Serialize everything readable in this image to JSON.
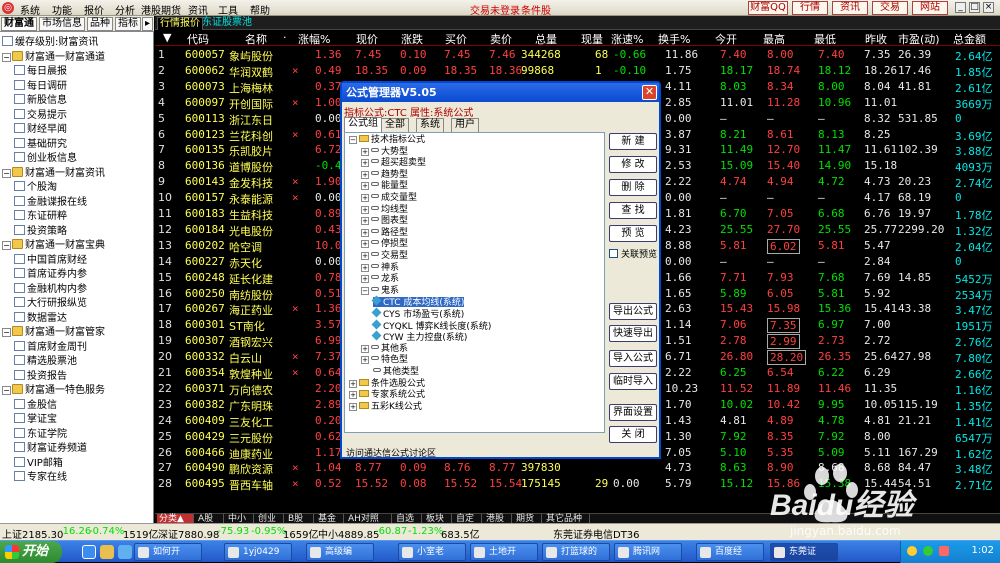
{
  "menubar": {
    "items": [
      "系统",
      "功能",
      "报价",
      "分析",
      "港股期货",
      "资讯",
      "工具",
      "帮助"
    ],
    "login_status": "交易未登录",
    "alert": "条件股",
    "right_buttons": [
      "财富QQ",
      "行情",
      "资讯",
      "交易",
      "网站"
    ]
  },
  "sidebar": {
    "tabs": [
      "财富通",
      "市场信息",
      "品种",
      "指标"
    ],
    "items": [
      {
        "type": "doc",
        "label": "缓存级别:财富资讯",
        "indent": 0
      },
      {
        "type": "folder",
        "label": "财富通一财富通道",
        "indent": 0
      },
      {
        "type": "doc",
        "label": "每日晨报",
        "indent": 1
      },
      {
        "type": "doc",
        "label": "每日调研",
        "indent": 1
      },
      {
        "type": "doc",
        "label": "新股信息",
        "indent": 1
      },
      {
        "type": "doc",
        "label": "交易提示",
        "indent": 1
      },
      {
        "type": "doc",
        "label": "财经早闻",
        "indent": 1
      },
      {
        "type": "doc",
        "label": "基础研究",
        "indent": 1
      },
      {
        "type": "doc",
        "label": "创业板信息",
        "indent": 1
      },
      {
        "type": "folder",
        "label": "财富通一财富资讯",
        "indent": 0
      },
      {
        "type": "doc",
        "label": "个股淘",
        "indent": 1
      },
      {
        "type": "doc",
        "label": "金融谍报在线",
        "indent": 1
      },
      {
        "type": "doc",
        "label": "东证研粹",
        "indent": 1
      },
      {
        "type": "doc",
        "label": "投资策略",
        "indent": 1
      },
      {
        "type": "folder",
        "label": "财富通一财富宝典",
        "indent": 0
      },
      {
        "type": "doc",
        "label": "中国首席财经",
        "indent": 1
      },
      {
        "type": "doc",
        "label": "首席证券内参",
        "indent": 1
      },
      {
        "type": "doc",
        "label": "金融机构内参",
        "indent": 1
      },
      {
        "type": "doc",
        "label": "大行研报纵览",
        "indent": 1
      },
      {
        "type": "doc",
        "label": "数据雷达",
        "indent": 1
      },
      {
        "type": "folder",
        "label": "财富通一财富管家",
        "indent": 0
      },
      {
        "type": "doc",
        "label": "首席财金周刊",
        "indent": 1
      },
      {
        "type": "doc",
        "label": "精选股票池",
        "indent": 1
      },
      {
        "type": "doc",
        "label": "投资报告",
        "indent": 1
      },
      {
        "type": "folder",
        "label": "财富通一特色服务",
        "indent": 0
      },
      {
        "type": "doc",
        "label": "金股信",
        "indent": 1
      },
      {
        "type": "doc",
        "label": "掌证宝",
        "indent": 1
      },
      {
        "type": "doc",
        "label": "东证学院",
        "indent": 1
      },
      {
        "type": "doc",
        "label": "财富证券频道",
        "indent": 1
      },
      {
        "type": "doc",
        "label": "VIP邮箱",
        "indent": 1
      },
      {
        "type": "doc",
        "label": "专家在线",
        "indent": 1
      }
    ]
  },
  "main": {
    "tabs": [
      "行情报价",
      "东证股票池"
    ],
    "columns": [
      "代码",
      "名称",
      "·",
      "涨幅%",
      "现价",
      "涨跌",
      "买价",
      "卖价",
      "总量",
      "现量",
      "涨速%",
      "换手%",
      "今开",
      "最高",
      "最低",
      "昨收",
      "市盈(动)",
      "总金额"
    ],
    "rows": [
      {
        "n": "1",
        "code": "600057",
        "name": "象屿股份",
        "flag": "",
        "chg": "1.36",
        "price": "7.45",
        "diff": "0.10",
        "bid": "7.45",
        "ask": "7.46",
        "vol": "344268",
        "cur": "68",
        "speed": "-0.66",
        "turn": "11.86",
        "open": "7.40",
        "high": "8.00",
        "low": "7.40",
        "prev": "7.35",
        "pe": "26.39",
        "amt": "2.64亿"
      },
      {
        "n": "2",
        "code": "600062",
        "name": "华润双鹤",
        "flag": "×",
        "chg": "0.49",
        "price": "18.35",
        "diff": "0.09",
        "bid": "18.35",
        "ask": "18.36",
        "vol": "99868",
        "cur": "1",
        "speed": "-0.10",
        "turn": "1.75",
        "open": "18.17",
        "high": "18.74",
        "low": "18.12",
        "prev": "18.26",
        "pe": "17.46",
        "amt": "1.85亿"
      },
      {
        "n": "3",
        "code": "600073",
        "name": "上海梅林",
        "flag": "",
        "chg": "0.37",
        "price": "",
        "diff": "",
        "bid": "",
        "ask": "",
        "vol": "",
        "cur": "",
        "speed": "",
        "turn": "4.11",
        "open": "8.03",
        "high": "8.34",
        "low": "8.00",
        "prev": "8.04",
        "pe": "41.81",
        "amt": "2.61亿"
      },
      {
        "n": "4",
        "code": "600097",
        "name": "开创国际",
        "flag": "×",
        "chg": "1.00",
        "price": "",
        "diff": "",
        "bid": "",
        "ask": "",
        "vol": "",
        "cur": "",
        "speed": "",
        "turn": "2.85",
        "open": "11.01",
        "high": "11.28",
        "low": "10.96",
        "prev": "11.01",
        "pe": "",
        "amt": "3669万"
      },
      {
        "n": "5",
        "code": "600113",
        "name": "浙江东日",
        "flag": "",
        "chg": "0.00",
        "price": "",
        "diff": "",
        "bid": "",
        "ask": "",
        "vol": "",
        "cur": "",
        "speed": "",
        "turn": "0.00",
        "open": "—",
        "high": "—",
        "low": "—",
        "prev": "8.32",
        "pe": "531.85",
        "amt": "0"
      },
      {
        "n": "6",
        "code": "600123",
        "name": "兰花科创",
        "flag": "×",
        "chg": "0.61",
        "price": "",
        "diff": "",
        "bid": "",
        "ask": "",
        "vol": "",
        "cur": "",
        "speed": "",
        "turn": "3.87",
        "open": "8.21",
        "high": "8.61",
        "low": "8.13",
        "prev": "8.25",
        "pe": "",
        "amt": "3.69亿"
      },
      {
        "n": "7",
        "code": "600135",
        "name": "乐凯胶片",
        "flag": "",
        "chg": "6.72",
        "price": "",
        "diff": "",
        "bid": "",
        "ask": "",
        "vol": "",
        "cur": "",
        "speed": "",
        "turn": "9.31",
        "open": "11.49",
        "high": "12.70",
        "low": "11.47",
        "prev": "11.61",
        "pe": "102.39",
        "amt": "3.88亿"
      },
      {
        "n": "8",
        "code": "600136",
        "name": "道博股份",
        "flag": "",
        "chg": "-0.40",
        "price": "",
        "diff": "",
        "bid": "",
        "ask": "",
        "vol": "",
        "cur": "",
        "speed": "",
        "turn": "2.53",
        "open": "15.09",
        "high": "15.40",
        "low": "14.90",
        "prev": "15.18",
        "pe": "",
        "amt": "4093万"
      },
      {
        "n": "9",
        "code": "600143",
        "name": "金发科技",
        "flag": "×",
        "chg": "1.90",
        "price": "",
        "diff": "",
        "bid": "",
        "ask": "",
        "vol": "",
        "cur": "",
        "speed": "",
        "turn": "2.22",
        "open": "4.74",
        "high": "4.94",
        "low": "4.72",
        "prev": "4.73",
        "pe": "20.23",
        "amt": "2.74亿"
      },
      {
        "n": "10",
        "code": "600157",
        "name": "永泰能源",
        "flag": "×",
        "chg": "0.00",
        "price": "",
        "diff": "",
        "bid": "",
        "ask": "",
        "vol": "",
        "cur": "",
        "speed": "",
        "turn": "0.00",
        "open": "—",
        "high": "—",
        "low": "—",
        "prev": "4.17",
        "pe": "68.19",
        "amt": "0"
      },
      {
        "n": "11",
        "code": "600183",
        "name": "生益科技",
        "flag": "",
        "chg": "0.89",
        "price": "",
        "diff": "",
        "bid": "",
        "ask": "",
        "vol": "",
        "cur": "",
        "speed": "",
        "turn": "1.81",
        "open": "6.70",
        "high": "7.05",
        "low": "6.68",
        "prev": "6.76",
        "pe": "19.97",
        "amt": "1.78亿"
      },
      {
        "n": "12",
        "code": "600184",
        "name": "光电股份",
        "flag": "",
        "chg": "0.43",
        "price": "",
        "diff": "",
        "bid": "",
        "ask": "",
        "vol": "",
        "cur": "",
        "speed": "",
        "turn": "4.23",
        "open": "25.55",
        "high": "27.70",
        "low": "25.55",
        "prev": "25.77",
        "pe": "2299.20",
        "amt": "1.32亿"
      },
      {
        "n": "13",
        "code": "600202",
        "name": "哈空调",
        "flag": "",
        "chg": "10.05",
        "price": "",
        "diff": "",
        "bid": "",
        "ask": "",
        "vol": "",
        "cur": "",
        "speed": "",
        "turn": "8.88",
        "open": "5.81",
        "high": "6.02",
        "low": "5.81",
        "prev": "5.47",
        "pe": "",
        "amt": "2.04亿"
      },
      {
        "n": "14",
        "code": "600227",
        "name": "赤天化",
        "flag": "",
        "chg": "0.00",
        "price": "",
        "diff": "",
        "bid": "",
        "ask": "",
        "vol": "",
        "cur": "",
        "speed": "",
        "turn": "0.00",
        "open": "—",
        "high": "—",
        "low": "—",
        "prev": "2.84",
        "pe": "",
        "amt": "0"
      },
      {
        "n": "15",
        "code": "600248",
        "name": "延长化建",
        "flag": "",
        "chg": "0.78",
        "price": "",
        "diff": "",
        "bid": "",
        "ask": "",
        "vol": "",
        "cur": "",
        "speed": "",
        "turn": "1.66",
        "open": "7.71",
        "high": "7.93",
        "low": "7.68",
        "prev": "7.69",
        "pe": "14.85",
        "amt": "5452万"
      },
      {
        "n": "16",
        "code": "600250",
        "name": "南纺股份",
        "flag": "",
        "chg": "0.51",
        "price": "",
        "diff": "",
        "bid": "",
        "ask": "",
        "vol": "",
        "cur": "",
        "speed": "",
        "turn": "1.65",
        "open": "5.89",
        "high": "6.05",
        "low": "5.81",
        "prev": "5.92",
        "pe": "",
        "amt": "2534万"
      },
      {
        "n": "17",
        "code": "600267",
        "name": "海正药业",
        "flag": "×",
        "chg": "1.36",
        "price": "",
        "diff": "",
        "bid": "",
        "ask": "",
        "vol": "",
        "cur": "",
        "speed": "",
        "turn": "2.63",
        "open": "15.43",
        "high": "15.98",
        "low": "15.36",
        "prev": "15.41",
        "pe": "43.38",
        "amt": "3.47亿"
      },
      {
        "n": "18",
        "code": "600301",
        "name": "ST南化",
        "flag": "",
        "chg": "3.57",
        "price": "",
        "diff": "",
        "bid": "",
        "ask": "",
        "vol": "",
        "cur": "",
        "speed": "",
        "turn": "1.14",
        "open": "7.06",
        "high": "7.35",
        "low": "6.97",
        "prev": "7.00",
        "pe": "",
        "amt": "1951万"
      },
      {
        "n": "19",
        "code": "600307",
        "name": "酒钢宏兴",
        "flag": "",
        "chg": "6.99",
        "price": "",
        "diff": "",
        "bid": "",
        "ask": "",
        "vol": "",
        "cur": "",
        "speed": "",
        "turn": "1.51",
        "open": "2.78",
        "high": "2.99",
        "low": "2.73",
        "prev": "2.72",
        "pe": "",
        "amt": "2.76亿"
      },
      {
        "n": "20",
        "code": "600332",
        "name": "白云山",
        "flag": "×",
        "chg": "7.37",
        "price": "",
        "diff": "",
        "bid": "",
        "ask": "",
        "vol": "",
        "cur": "",
        "speed": "",
        "turn": "6.71",
        "open": "26.80",
        "high": "28.20",
        "low": "26.35",
        "prev": "25.64",
        "pe": "27.98",
        "amt": "7.80亿"
      },
      {
        "n": "21",
        "code": "600354",
        "name": "敦煌种业",
        "flag": "×",
        "chg": "0.64",
        "price": "",
        "diff": "",
        "bid": "",
        "ask": "",
        "vol": "",
        "cur": "",
        "speed": "",
        "turn": "2.22",
        "open": "6.25",
        "high": "6.54",
        "low": "6.22",
        "prev": "6.29",
        "pe": "",
        "amt": "2.66亿"
      },
      {
        "n": "22",
        "code": "600371",
        "name": "万向德农",
        "flag": "",
        "chg": "2.20",
        "price": "",
        "diff": "",
        "bid": "",
        "ask": "",
        "vol": "",
        "cur": "",
        "speed": "",
        "turn": "10.23",
        "open": "11.52",
        "high": "11.89",
        "low": "11.46",
        "prev": "11.35",
        "pe": "",
        "amt": "1.16亿"
      },
      {
        "n": "23",
        "code": "600382",
        "name": "广东明珠",
        "flag": "",
        "chg": "2.89",
        "price": "",
        "diff": "",
        "bid": "",
        "ask": "",
        "vol": "",
        "cur": "",
        "speed": "",
        "turn": "1.70",
        "open": "10.02",
        "high": "10.42",
        "low": "9.95",
        "prev": "10.05",
        "pe": "115.19",
        "amt": "1.35亿"
      },
      {
        "n": "24",
        "code": "600409",
        "name": "三友化工",
        "flag": "",
        "chg": "0.20",
        "price": "",
        "diff": "",
        "bid": "",
        "ask": "",
        "vol": "",
        "cur": "",
        "speed": "",
        "turn": "1.43",
        "open": "4.81",
        "high": "4.89",
        "low": "4.78",
        "prev": "4.81",
        "pe": "21.21",
        "amt": "1.41亿"
      },
      {
        "n": "25",
        "code": "600429",
        "name": "三元股份",
        "flag": "",
        "chg": "0.62",
        "price": "",
        "diff": "",
        "bid": "",
        "ask": "",
        "vol": "",
        "cur": "",
        "speed": "",
        "turn": "1.30",
        "open": "7.92",
        "high": "8.35",
        "low": "7.92",
        "prev": "8.00",
        "pe": "",
        "amt": "6547万"
      },
      {
        "n": "26",
        "code": "600466",
        "name": "迪康药业",
        "flag": "",
        "chg": "1.17",
        "price": "",
        "diff": "",
        "bid": "",
        "ask": "",
        "vol": "",
        "cur": "",
        "speed": "",
        "turn": "7.05",
        "open": "5.10",
        "high": "5.35",
        "low": "5.09",
        "prev": "5.11",
        "pe": "167.29",
        "amt": "1.62亿"
      },
      {
        "n": "27",
        "code": "600490",
        "name": "鹏欣资源",
        "flag": "×",
        "chg": "1.04",
        "price": "8.77",
        "diff": "0.09",
        "bid": "8.76",
        "ask": "8.77",
        "vol": "397830",
        "cur": "",
        "speed": "",
        "turn": "4.73",
        "open": "8.63",
        "high": "8.90",
        "low": "8.68",
        "prev": "8.68",
        "pe": "84.47",
        "amt": "3.48亿"
      },
      {
        "n": "28",
        "code": "600495",
        "name": "晋西车轴",
        "flag": "×",
        "chg": "0.52",
        "price": "15.52",
        "diff": "0.08",
        "bid": "15.52",
        "ask": "15.54",
        "vol": "175145",
        "cur": "29",
        "speed": "0.00",
        "turn": "5.79",
        "open": "15.12",
        "high": "15.86",
        "low": "15.38",
        "prev": "15.44",
        "pe": "54.51",
        "amt": "2.71亿"
      }
    ]
  },
  "bottom_tabs": [
    "分类▲",
    "A股",
    "中小",
    "创业",
    "B股",
    "基金",
    "AH对照",
    "自选",
    "板块",
    "自定",
    "港股",
    "期货",
    "其它品种"
  ],
  "status": {
    "sh": "上证2185.30",
    "sh_chg": "-16.26",
    "sh_pct": "-0.74%",
    "sh_amt": "1519亿",
    "sz": "深证7880.98",
    "sz_chg": "-75.93",
    "sz_pct": "-0.95%",
    "sz_amt": "1659亿",
    "sme": "中小4889.85",
    "sme_chg": "-60.87",
    "sme_pct": "-1.23%",
    "sme_amt": "683.5亿",
    "broker": "东莞证券电信DT36"
  },
  "taskbar": {
    "start": "开始",
    "items": [
      "如何开",
      "1yj0429",
      "高级编",
      "小室老",
      "土地开",
      "打篮球的",
      "腾讯网",
      "百度经",
      "东莞证"
    ],
    "clock": "1:02"
  },
  "dialog": {
    "title": "公式管理器V5.05",
    "subtitle": "指标公式:CTC 属性:系统公式",
    "tabs": [
      "公式组",
      "全部",
      "系统",
      "用户"
    ],
    "tree": [
      {
        "label": "技术指标公式",
        "level": 0,
        "kind": "folder",
        "pm": "-"
      },
      {
        "label": "大势型",
        "level": 1,
        "kind": "key",
        "pm": "+"
      },
      {
        "label": "超买超卖型",
        "level": 1,
        "kind": "key",
        "pm": "+"
      },
      {
        "label": "趋势型",
        "level": 1,
        "kind": "key",
        "pm": "+"
      },
      {
        "label": "能量型",
        "level": 1,
        "kind": "key",
        "pm": "+"
      },
      {
        "label": "成交量型",
        "level": 1,
        "kind": "key",
        "pm": "+"
      },
      {
        "label": "均线型",
        "level": 1,
        "kind": "key",
        "pm": "+"
      },
      {
        "label": "图表型",
        "level": 1,
        "kind": "key",
        "pm": "+"
      },
      {
        "label": "路径型",
        "level": 1,
        "kind": "key",
        "pm": "+"
      },
      {
        "label": "停损型",
        "level": 1,
        "kind": "key",
        "pm": "+"
      },
      {
        "label": "交易型",
        "level": 1,
        "kind": "key",
        "pm": "+"
      },
      {
        "label": "神系",
        "level": 1,
        "kind": "key",
        "pm": "+"
      },
      {
        "label": "龙系",
        "level": 1,
        "kind": "key",
        "pm": "+"
      },
      {
        "label": "鬼系",
        "level": 1,
        "kind": "key",
        "pm": "-"
      },
      {
        "label": "CTC  成本均线(系统)",
        "level": 2,
        "kind": "item",
        "sel": true
      },
      {
        "label": "CYS  市场盈亏(系统)",
        "level": 2,
        "kind": "item"
      },
      {
        "label": "CYQKL  博弈K线长度(系统)",
        "level": 2,
        "kind": "item"
      },
      {
        "label": "CYW  主力控盘(系统)",
        "level": 2,
        "kind": "item"
      },
      {
        "label": "其他系",
        "level": 1,
        "kind": "key",
        "pm": "+"
      },
      {
        "label": "特色型",
        "level": 1,
        "kind": "key",
        "pm": "+"
      },
      {
        "label": "其他类型",
        "level": 1,
        "kind": "key",
        "pm": ""
      },
      {
        "label": "条件选股公式",
        "level": 0,
        "kind": "folder",
        "pm": "+"
      },
      {
        "label": "专家系统公式",
        "level": 0,
        "kind": "folder",
        "pm": "+"
      },
      {
        "label": "五彩K线公式",
        "level": 0,
        "kind": "folder",
        "pm": "+"
      }
    ],
    "buttons_top": [
      "新 建",
      "修 改",
      "删 除",
      "查 找",
      "预 览"
    ],
    "check_label": "关联预览",
    "buttons_bottom": [
      "导出公式",
      "快速导出",
      "导入公式",
      "临时导入",
      "界面设置",
      "关 闭"
    ],
    "footer": "访问通达信公式讨论区"
  },
  "watermark": {
    "text": "Baidu经验",
    "url": "jingyan.baidu.com"
  }
}
